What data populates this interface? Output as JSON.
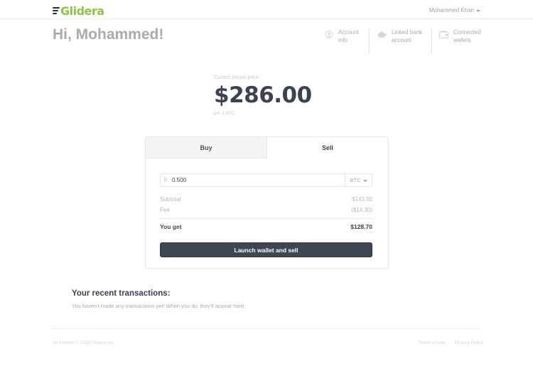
{
  "header": {
    "brand": "Glidera",
    "user_name": "Mohammed Khan"
  },
  "greeting": "Hi, Mohammed!",
  "quick_links": [
    {
      "label": "Account\ninfo",
      "icon": "user-icon"
    },
    {
      "label": "Linked bank\naccount",
      "icon": "piggy-bank-icon"
    },
    {
      "label": "Connected\nwallets",
      "icon": "wallet-icon"
    }
  ],
  "price": {
    "caption": "Current bitcoin price:",
    "value": "$286.00",
    "unit": "per 1 BTC"
  },
  "trade": {
    "tabs": [
      "Buy",
      "Sell"
    ],
    "active_tab": "Sell",
    "amount_icon": "₿",
    "amount": "0.500",
    "currency": "BTC",
    "subtotal_label": "Subtotal",
    "subtotal_value": "$143.00",
    "fee_label": "Fee",
    "fee_value": "($14.30)",
    "total_label": "You get",
    "total_value": "$128.70",
    "action_label": "Launch wallet and sell"
  },
  "recent": {
    "title": "Your recent transactions:",
    "empty_message": "You haven't made any transactions yet! When you do, they'll appear here."
  },
  "footer": {
    "copyright": "All content © 2015 Glidera Inc.",
    "links": [
      "Terms of Use",
      "Privacy Policy"
    ]
  },
  "colors": {
    "brand_green": "#8cc63f",
    "primary_button": "#3d4651",
    "text_dark": "#3a4450",
    "text_muted": "#a4abb2"
  }
}
